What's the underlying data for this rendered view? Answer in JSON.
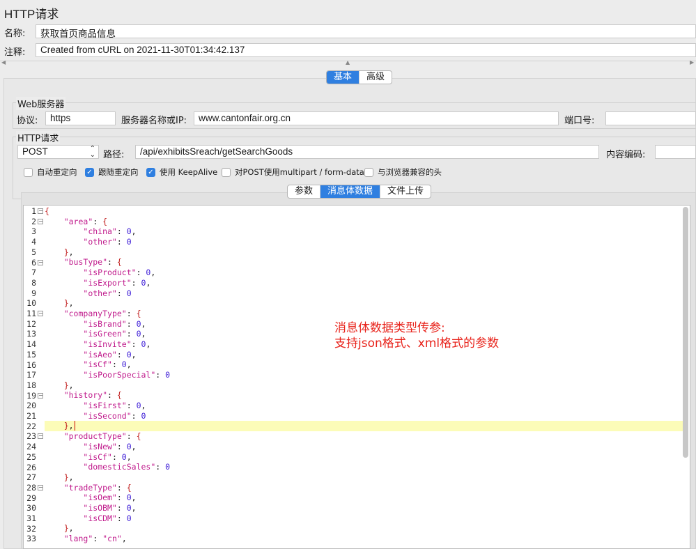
{
  "window": {
    "title": "HTTP请求"
  },
  "name": {
    "label": "名称:",
    "value": "获取首页商品信息"
  },
  "comment": {
    "label": "注释:",
    "value": "Created from cURL on 2021-11-30T01:34:42.137"
  },
  "tabs": [
    "基本",
    "高级"
  ],
  "tabs_active": "基本",
  "web_server": {
    "legend": "Web服务器",
    "protocol_label": "协议:",
    "protocol_value": "https",
    "server_label": "服务器名称或IP:",
    "server_value": "www.cantonfair.org.cn",
    "port_label": "端口号:",
    "port_value": ""
  },
  "http_request": {
    "legend": "HTTP请求",
    "method": "POST",
    "path_label": "路径:",
    "path_value": "/api/exhibitsSreach/getSearchGoods",
    "encoding_label": "内容编码:",
    "encoding_value": ""
  },
  "options": [
    {
      "label": "自动重定向",
      "checked": false
    },
    {
      "label": "跟随重定向",
      "checked": true
    },
    {
      "label": "使用 KeepAlive",
      "checked": true
    },
    {
      "label": "对POST使用multipart / form-data",
      "checked": false
    },
    {
      "label": "与浏览器兼容的头",
      "checked": false
    }
  ],
  "sub_tabs": [
    "参数",
    "消息体数据",
    "文件上传"
  ],
  "sub_tabs_active": "消息体数据",
  "editor": {
    "highlight_line": 22,
    "lines": [
      {
        "n": "1",
        "fold": true,
        "text": "{"
      },
      {
        "n": "2",
        "fold": true,
        "text": "    \"area\": {"
      },
      {
        "n": "3",
        "fold": false,
        "text": "        \"china\": 0,"
      },
      {
        "n": "4",
        "fold": false,
        "text": "        \"other\": 0"
      },
      {
        "n": "5",
        "fold": false,
        "text": "    },"
      },
      {
        "n": "6",
        "fold": true,
        "text": "    \"busType\": {"
      },
      {
        "n": "7",
        "fold": false,
        "text": "        \"isProduct\": 0,"
      },
      {
        "n": "8",
        "fold": false,
        "text": "        \"isExport\": 0,"
      },
      {
        "n": "9",
        "fold": false,
        "text": "        \"other\": 0"
      },
      {
        "n": "10",
        "fold": false,
        "text": "    },"
      },
      {
        "n": "11",
        "fold": true,
        "text": "    \"companyType\": {"
      },
      {
        "n": "12",
        "fold": false,
        "text": "        \"isBrand\": 0,"
      },
      {
        "n": "13",
        "fold": false,
        "text": "        \"isGreen\": 0,"
      },
      {
        "n": "14",
        "fold": false,
        "text": "        \"isInvite\": 0,"
      },
      {
        "n": "15",
        "fold": false,
        "text": "        \"isAeo\": 0,"
      },
      {
        "n": "16",
        "fold": false,
        "text": "        \"isCf\": 0,"
      },
      {
        "n": "17",
        "fold": false,
        "text": "        \"isPoorSpecial\": 0"
      },
      {
        "n": "18",
        "fold": false,
        "text": "    },"
      },
      {
        "n": "19",
        "fold": true,
        "text": "    \"history\": {"
      },
      {
        "n": "20",
        "fold": false,
        "text": "        \"isFirst\": 0,"
      },
      {
        "n": "21",
        "fold": false,
        "text": "        \"isSecond\": 0"
      },
      {
        "n": "22",
        "fold": false,
        "text": "    },"
      },
      {
        "n": "23",
        "fold": true,
        "text": "    \"productType\": {"
      },
      {
        "n": "24",
        "fold": false,
        "text": "        \"isNew\": 0,"
      },
      {
        "n": "25",
        "fold": false,
        "text": "        \"isCf\": 0,"
      },
      {
        "n": "26",
        "fold": false,
        "text": "        \"domesticSales\": 0"
      },
      {
        "n": "27",
        "fold": false,
        "text": "    },"
      },
      {
        "n": "28",
        "fold": true,
        "text": "    \"tradeType\": {"
      },
      {
        "n": "29",
        "fold": false,
        "text": "        \"isOem\": 0,"
      },
      {
        "n": "30",
        "fold": false,
        "text": "        \"isOBM\": 0,"
      },
      {
        "n": "31",
        "fold": false,
        "text": "        \"isCDM\": 0"
      },
      {
        "n": "32",
        "fold": false,
        "text": "    },"
      },
      {
        "n": "33",
        "fold": false,
        "text": "    \"lang\": \"cn\","
      }
    ]
  },
  "annotation": {
    "line1": "消息体数据类型传参:",
    "line2": "支持json格式、xml格式的参数",
    "color": "#e8231b"
  },
  "colors": {
    "accent": "#2f7fe0",
    "key": "#c01a8c",
    "number": "#3c1bd6",
    "brace": "#c01a1a",
    "highlight": "#fcfcb8"
  }
}
